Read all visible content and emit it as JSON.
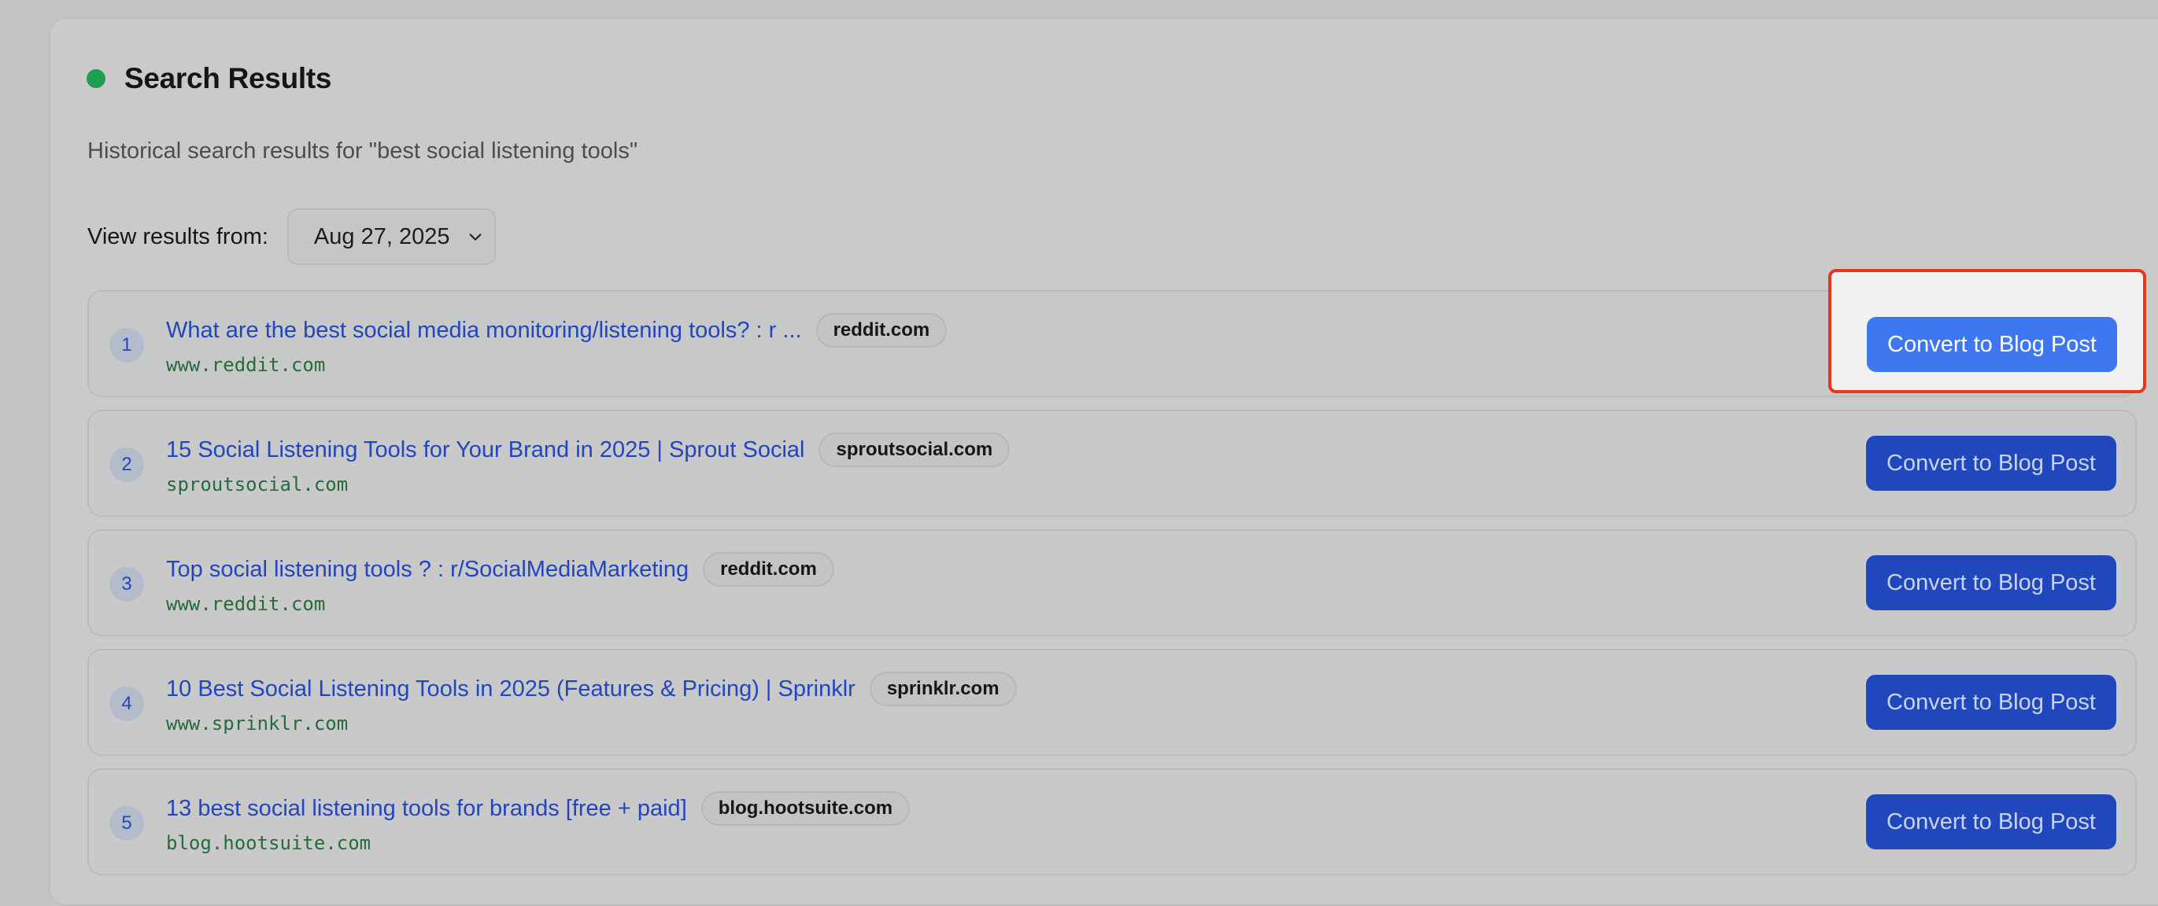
{
  "header": {
    "title": "Search Results",
    "subtitle": "Historical search results for \"best social listening tools\""
  },
  "filter": {
    "label": "View results from:",
    "selected_date": "Aug 27, 2025"
  },
  "results": [
    {
      "rank": "1",
      "title": "What are the best social media monitoring/listening tools? : r ...",
      "domain": "reddit.com",
      "url": "www.reddit.com",
      "button_label": "Convert to Blog Post"
    },
    {
      "rank": "2",
      "title": "15 Social Listening Tools for Your Brand in 2025 | Sprout Social",
      "domain": "sproutsocial.com",
      "url": "sproutsocial.com",
      "button_label": "Convert to Blog Post"
    },
    {
      "rank": "3",
      "title": "Top social listening tools ? : r/SocialMediaMarketing",
      "domain": "reddit.com",
      "url": "www.reddit.com",
      "button_label": "Convert to Blog Post"
    },
    {
      "rank": "4",
      "title": "10 Best Social Listening Tools in 2025 (Features & Pricing) | Sprinklr",
      "domain": "sprinklr.com",
      "url": "www.sprinklr.com",
      "button_label": "Convert to Blog Post"
    },
    {
      "rank": "5",
      "title": "13 best social listening tools for brands [free + paid]",
      "domain": "blog.hootsuite.com",
      "url": "blog.hootsuite.com",
      "button_label": "Convert to Blog Post"
    }
  ],
  "icons": {
    "status": "status-dot-icon",
    "dropdown": "chevron-down-icon"
  },
  "colors": {
    "status_green": "#1f9e52",
    "link_blue": "#2146be",
    "primary_button": "#2047bb",
    "highlight_border": "#e2381f"
  }
}
